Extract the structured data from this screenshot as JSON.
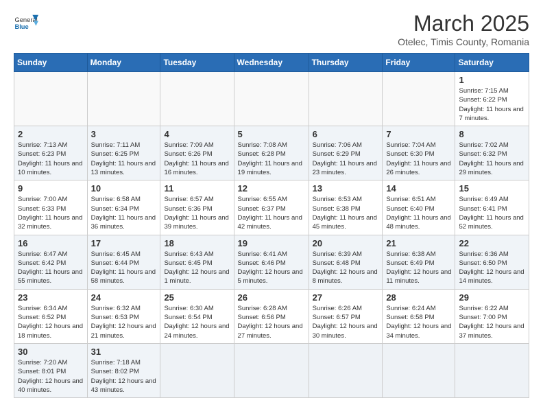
{
  "logo": {
    "text_general": "General",
    "text_blue": "Blue"
  },
  "header": {
    "title": "March 2025",
    "subtitle": "Otelec, Timis County, Romania"
  },
  "weekdays": [
    "Sunday",
    "Monday",
    "Tuesday",
    "Wednesday",
    "Thursday",
    "Friday",
    "Saturday"
  ],
  "weeks": [
    [
      {
        "day": "",
        "info": ""
      },
      {
        "day": "",
        "info": ""
      },
      {
        "day": "",
        "info": ""
      },
      {
        "day": "",
        "info": ""
      },
      {
        "day": "",
        "info": ""
      },
      {
        "day": "",
        "info": ""
      },
      {
        "day": "1",
        "info": "Sunrise: 7:15 AM\nSunset: 6:22 PM\nDaylight: 11 hours and 7 minutes."
      }
    ],
    [
      {
        "day": "2",
        "info": "Sunrise: 7:13 AM\nSunset: 6:23 PM\nDaylight: 11 hours and 10 minutes."
      },
      {
        "day": "3",
        "info": "Sunrise: 7:11 AM\nSunset: 6:25 PM\nDaylight: 11 hours and 13 minutes."
      },
      {
        "day": "4",
        "info": "Sunrise: 7:09 AM\nSunset: 6:26 PM\nDaylight: 11 hours and 16 minutes."
      },
      {
        "day": "5",
        "info": "Sunrise: 7:08 AM\nSunset: 6:28 PM\nDaylight: 11 hours and 19 minutes."
      },
      {
        "day": "6",
        "info": "Sunrise: 7:06 AM\nSunset: 6:29 PM\nDaylight: 11 hours and 23 minutes."
      },
      {
        "day": "7",
        "info": "Sunrise: 7:04 AM\nSunset: 6:30 PM\nDaylight: 11 hours and 26 minutes."
      },
      {
        "day": "8",
        "info": "Sunrise: 7:02 AM\nSunset: 6:32 PM\nDaylight: 11 hours and 29 minutes."
      }
    ],
    [
      {
        "day": "9",
        "info": "Sunrise: 7:00 AM\nSunset: 6:33 PM\nDaylight: 11 hours and 32 minutes."
      },
      {
        "day": "10",
        "info": "Sunrise: 6:58 AM\nSunset: 6:34 PM\nDaylight: 11 hours and 36 minutes."
      },
      {
        "day": "11",
        "info": "Sunrise: 6:57 AM\nSunset: 6:36 PM\nDaylight: 11 hours and 39 minutes."
      },
      {
        "day": "12",
        "info": "Sunrise: 6:55 AM\nSunset: 6:37 PM\nDaylight: 11 hours and 42 minutes."
      },
      {
        "day": "13",
        "info": "Sunrise: 6:53 AM\nSunset: 6:38 PM\nDaylight: 11 hours and 45 minutes."
      },
      {
        "day": "14",
        "info": "Sunrise: 6:51 AM\nSunset: 6:40 PM\nDaylight: 11 hours and 48 minutes."
      },
      {
        "day": "15",
        "info": "Sunrise: 6:49 AM\nSunset: 6:41 PM\nDaylight: 11 hours and 52 minutes."
      }
    ],
    [
      {
        "day": "16",
        "info": "Sunrise: 6:47 AM\nSunset: 6:42 PM\nDaylight: 11 hours and 55 minutes."
      },
      {
        "day": "17",
        "info": "Sunrise: 6:45 AM\nSunset: 6:44 PM\nDaylight: 11 hours and 58 minutes."
      },
      {
        "day": "18",
        "info": "Sunrise: 6:43 AM\nSunset: 6:45 PM\nDaylight: 12 hours and 1 minute."
      },
      {
        "day": "19",
        "info": "Sunrise: 6:41 AM\nSunset: 6:46 PM\nDaylight: 12 hours and 5 minutes."
      },
      {
        "day": "20",
        "info": "Sunrise: 6:39 AM\nSunset: 6:48 PM\nDaylight: 12 hours and 8 minutes."
      },
      {
        "day": "21",
        "info": "Sunrise: 6:38 AM\nSunset: 6:49 PM\nDaylight: 12 hours and 11 minutes."
      },
      {
        "day": "22",
        "info": "Sunrise: 6:36 AM\nSunset: 6:50 PM\nDaylight: 12 hours and 14 minutes."
      }
    ],
    [
      {
        "day": "23",
        "info": "Sunrise: 6:34 AM\nSunset: 6:52 PM\nDaylight: 12 hours and 18 minutes."
      },
      {
        "day": "24",
        "info": "Sunrise: 6:32 AM\nSunset: 6:53 PM\nDaylight: 12 hours and 21 minutes."
      },
      {
        "day": "25",
        "info": "Sunrise: 6:30 AM\nSunset: 6:54 PM\nDaylight: 12 hours and 24 minutes."
      },
      {
        "day": "26",
        "info": "Sunrise: 6:28 AM\nSunset: 6:56 PM\nDaylight: 12 hours and 27 minutes."
      },
      {
        "day": "27",
        "info": "Sunrise: 6:26 AM\nSunset: 6:57 PM\nDaylight: 12 hours and 30 minutes."
      },
      {
        "day": "28",
        "info": "Sunrise: 6:24 AM\nSunset: 6:58 PM\nDaylight: 12 hours and 34 minutes."
      },
      {
        "day": "29",
        "info": "Sunrise: 6:22 AM\nSunset: 7:00 PM\nDaylight: 12 hours and 37 minutes."
      }
    ],
    [
      {
        "day": "30",
        "info": "Sunrise: 7:20 AM\nSunset: 8:01 PM\nDaylight: 12 hours and 40 minutes."
      },
      {
        "day": "31",
        "info": "Sunrise: 7:18 AM\nSunset: 8:02 PM\nDaylight: 12 hours and 43 minutes."
      },
      {
        "day": "",
        "info": ""
      },
      {
        "day": "",
        "info": ""
      },
      {
        "day": "",
        "info": ""
      },
      {
        "day": "",
        "info": ""
      },
      {
        "day": "",
        "info": ""
      }
    ]
  ]
}
